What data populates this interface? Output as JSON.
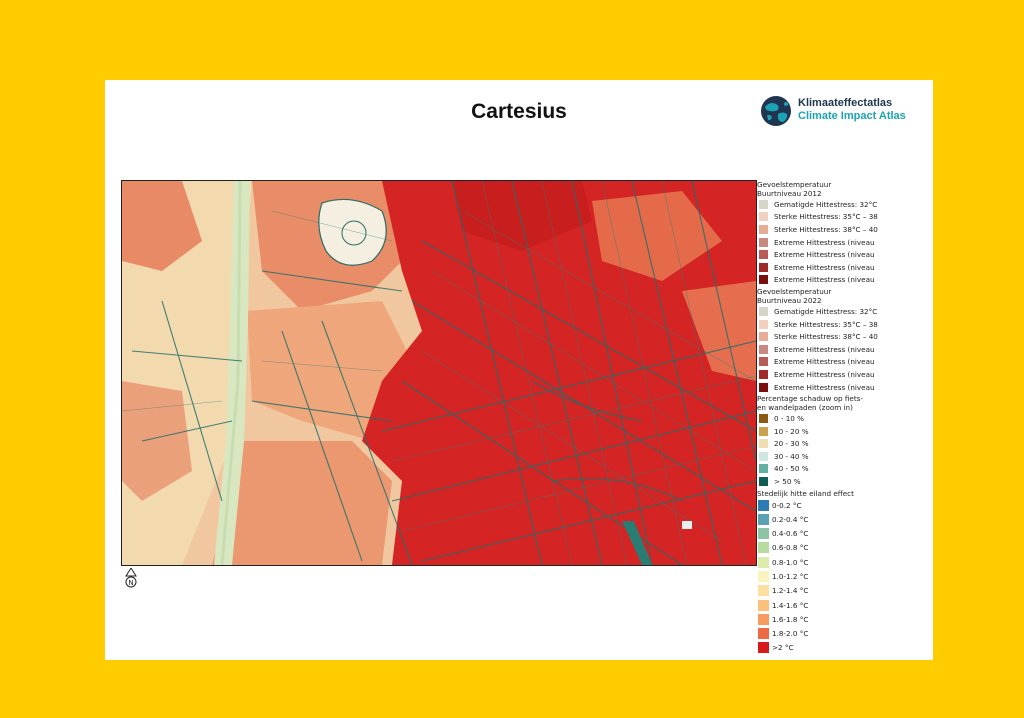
{
  "title": "Cartesius",
  "logo": {
    "icon": "globe-icon",
    "line1": "Klimaateffectatlas",
    "line2": "Climate Impact Atlas"
  },
  "north_arrow": {
    "icon": "north-arrow-icon",
    "letter": "N"
  },
  "colors": {
    "background": "#ffcc00",
    "sheet": "#ffffff",
    "logo_dark": "#1f3550",
    "logo_teal": "#1aa3b5",
    "street_shade": "#1f6f6a",
    "heat_low": "#f5e3b8",
    "heat_mid": "#ee9a72",
    "heat_high": "#d91e1e"
  },
  "legend": {
    "groups": [
      {
        "title": [
          "Gevoelstemperatuur",
          "Buurtniveau 2012"
        ],
        "items": [
          {
            "label": "Gematigde Hittestress: 32°C",
            "color": "#d6d6c8"
          },
          {
            "label": "Sterke Hittestress: 35°C – 38",
            "color": "#f1d0c0"
          },
          {
            "label": "Sterke Hittestress: 38°C – 40",
            "color": "#e6ad96"
          },
          {
            "label": "Extreme Hittestress (niveau",
            "color": "#c88a80"
          },
          {
            "label": "Extreme Hittestress (niveau",
            "color": "#b95a58"
          },
          {
            "label": "Extreme Hittestress (niveau",
            "color": "#9f2a2a"
          },
          {
            "label": "Extreme Hittestress (niveau",
            "color": "#7a0f0f"
          }
        ]
      },
      {
        "title": [
          "Gevoelstemperatuur",
          "Buurtniveau 2022"
        ],
        "items": [
          {
            "label": "Gematigde Hittestress: 32°C",
            "color": "#d6d6c8"
          },
          {
            "label": "Sterke Hittestress: 35°C – 38",
            "color": "#f1d0c0"
          },
          {
            "label": "Sterke Hittestress: 38°C – 40",
            "color": "#e6ad96"
          },
          {
            "label": "Extreme Hittestress (niveau",
            "color": "#c88a80"
          },
          {
            "label": "Extreme Hittestress (niveau",
            "color": "#b95a58"
          },
          {
            "label": "Extreme Hittestress (niveau",
            "color": "#9f2a2a"
          },
          {
            "label": "Extreme Hittestress (niveau",
            "color": "#7a0f0f"
          }
        ]
      },
      {
        "title": [
          "Percentage schaduw op fiets-",
          "en wandelpaden (zoom in)"
        ],
        "items": [
          {
            "label": "0 - 10 %",
            "color": "#8b5a12"
          },
          {
            "label": "10 - 20 %",
            "color": "#c9a24e"
          },
          {
            "label": "20 - 30 %",
            "color": "#f0ddb0"
          },
          {
            "label": "30 - 40 %",
            "color": "#cfe7e2"
          },
          {
            "label": "40 - 50 %",
            "color": "#5fb0a3"
          },
          {
            "label": "> 50 %",
            "color": "#0f5e55"
          }
        ]
      }
    ],
    "uhi": {
      "title": "Stedelijk hitte eiland effect",
      "items": [
        {
          "label": "0-0.2 °C",
          "color": "#2c7bb6"
        },
        {
          "label": "0.2-0.4 °C",
          "color": "#5aa2b2"
        },
        {
          "label": "0.4-0.6 °C",
          "color": "#8cc4a6"
        },
        {
          "label": "0.6-0.8 °C",
          "color": "#b8dba0"
        },
        {
          "label": "0.8-1.0 °C",
          "color": "#dcecaa"
        },
        {
          "label": "1.0-1.2 °C",
          "color": "#fbf3bf"
        },
        {
          "label": "1.2-1.4 °C",
          "color": "#fde0a0"
        },
        {
          "label": "1.4-1.6 °C",
          "color": "#fcc07a"
        },
        {
          "label": "1.6-1.8 °C",
          "color": "#f79a5e"
        },
        {
          "label": "1.8-2.0 °C",
          "color": "#ee6a45"
        },
        {
          "label": ">2 °C",
          "color": "#d7191c"
        }
      ]
    }
  }
}
